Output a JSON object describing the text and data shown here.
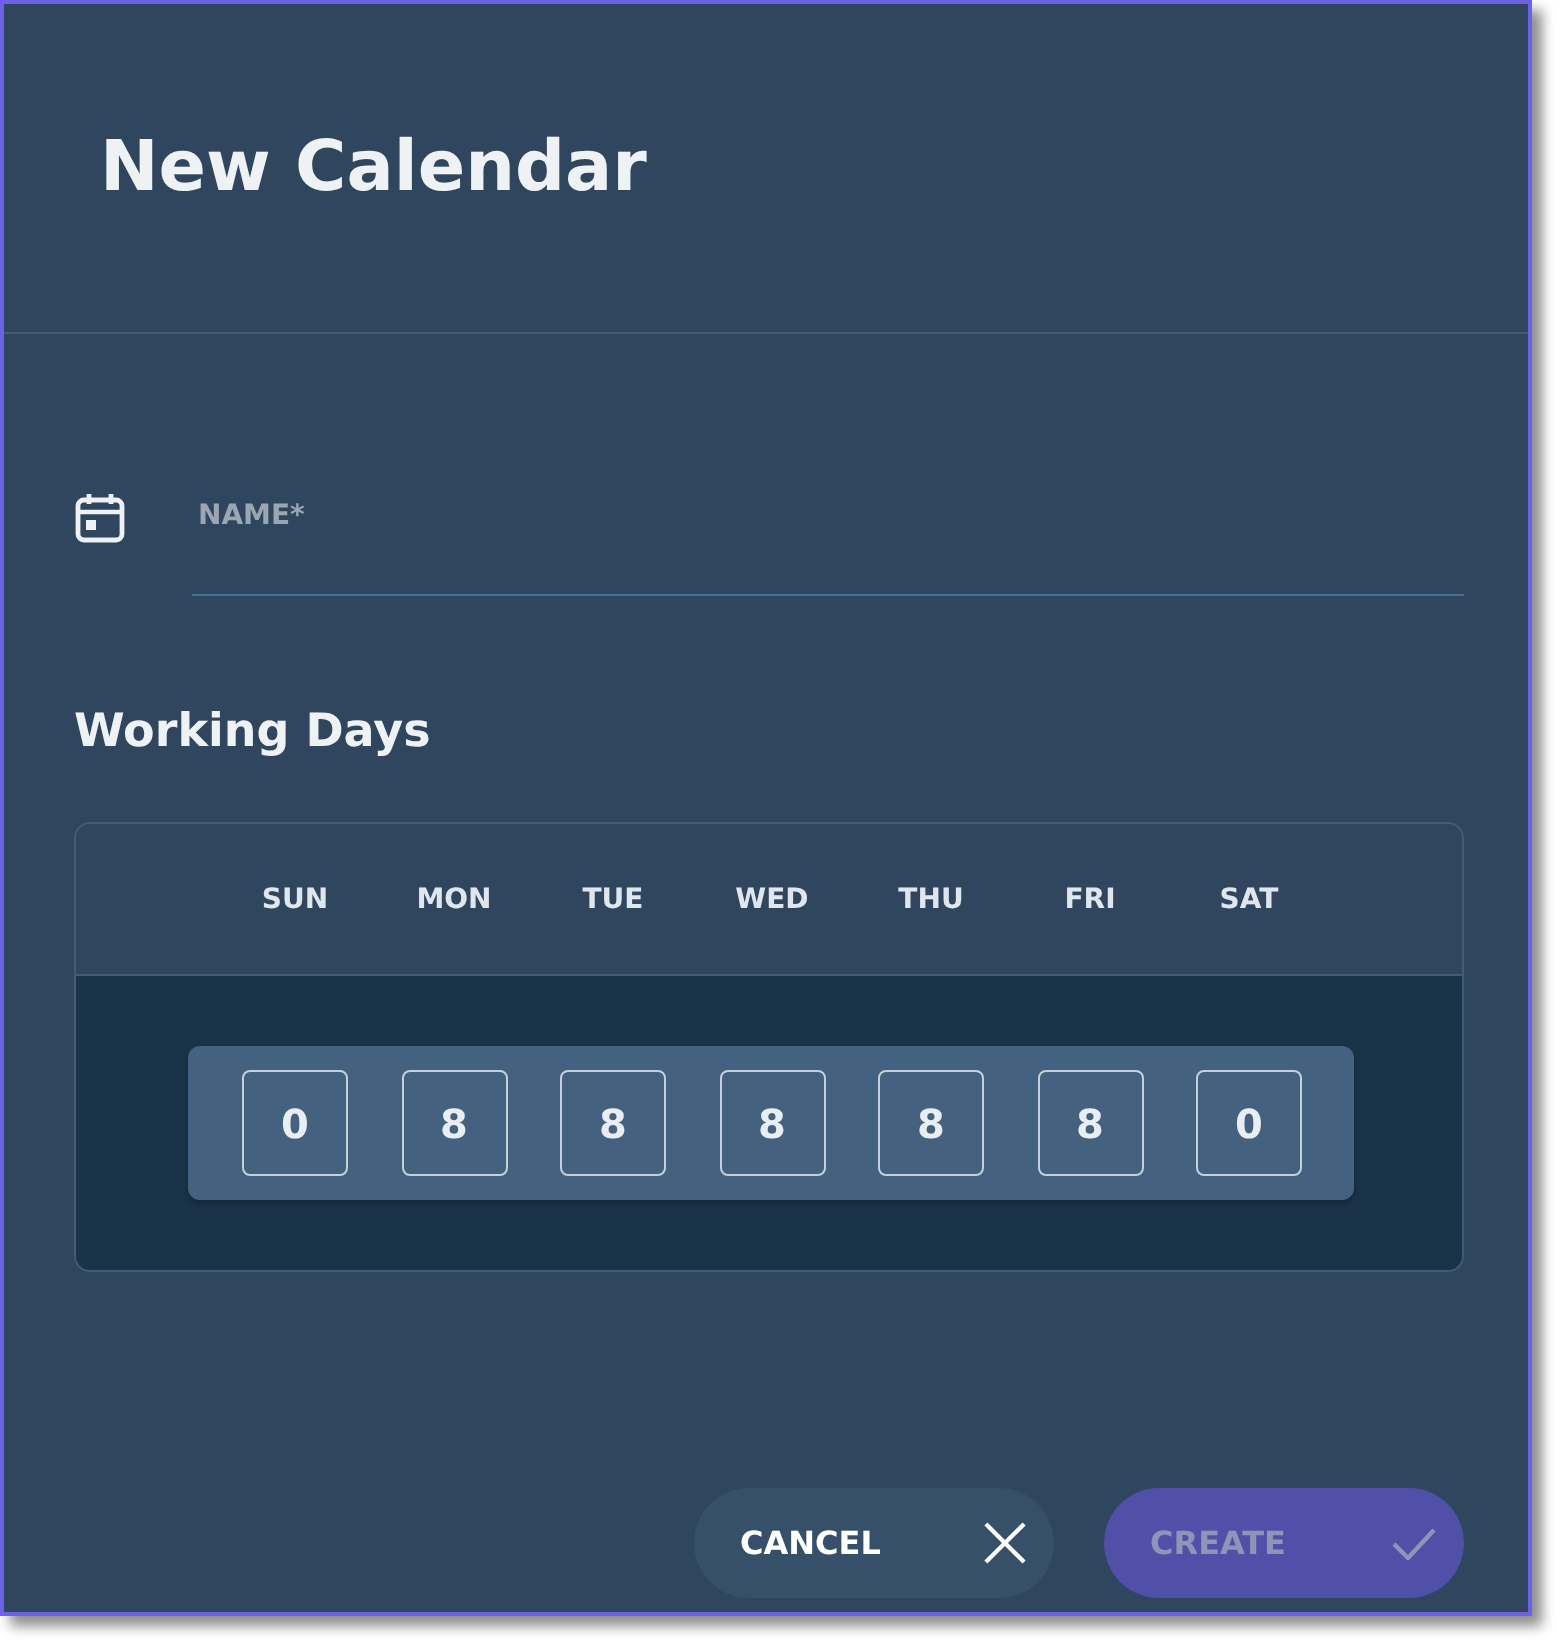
{
  "dialog": {
    "title": "New Calendar"
  },
  "name_field": {
    "placeholder": "NAME*"
  },
  "working_days": {
    "title": "Working Days",
    "days": [
      {
        "label": "SUN",
        "hours": "0"
      },
      {
        "label": "MON",
        "hours": "8"
      },
      {
        "label": "TUE",
        "hours": "8"
      },
      {
        "label": "WED",
        "hours": "8"
      },
      {
        "label": "THU",
        "hours": "8"
      },
      {
        "label": "FRI",
        "hours": "8"
      },
      {
        "label": "SAT",
        "hours": "0"
      }
    ]
  },
  "buttons": [
    {
      "label": "CANCEL",
      "kind": "cancel",
      "disabled": false
    },
    {
      "label": "CREATE",
      "kind": "create",
      "disabled": true
    }
  ]
}
